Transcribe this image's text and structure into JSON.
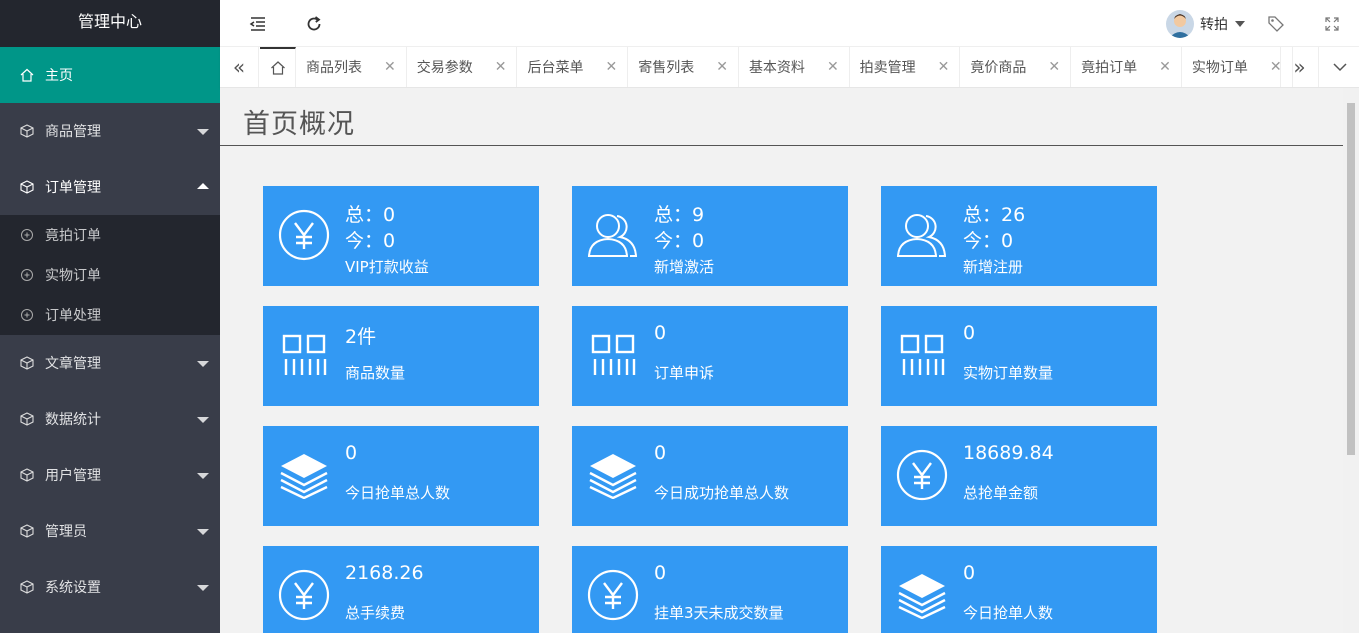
{
  "sidebar": {
    "title": "管理中心",
    "items": [
      {
        "label": "主页"
      },
      {
        "label": "商品管理"
      },
      {
        "label": "订单管理",
        "children": [
          {
            "label": "竟拍订单"
          },
          {
            "label": "实物订单"
          },
          {
            "label": "订单处理"
          }
        ]
      },
      {
        "label": "文章管理"
      },
      {
        "label": "数据统计"
      },
      {
        "label": "用户管理"
      },
      {
        "label": "管理员"
      },
      {
        "label": "系统设置"
      }
    ]
  },
  "header": {
    "user_name": "转拍",
    "icons": [
      "menu-fold-icon",
      "refresh-icon",
      "tag-icon",
      "fullscreen-icon"
    ]
  },
  "tabs": [
    "商品列表",
    "交易参数",
    "后台菜单",
    "寄售列表",
    "基本资料",
    "拍卖管理",
    "竟价商品",
    "竟拍订单",
    "实物订单"
  ],
  "page": {
    "title": "首页概况"
  },
  "cards": [
    {
      "total": "总：0",
      "today": "今：0",
      "caption": "VIP打款收益",
      "icon": "yen-icon"
    },
    {
      "total": "总：9",
      "today": "今：0",
      "caption": "新增激活",
      "icon": "users-icon"
    },
    {
      "total": "总：26",
      "today": "今：0",
      "caption": "新增注册",
      "icon": "users-icon"
    },
    {
      "value": "2件",
      "caption": "商品数量",
      "icon": "grid-icon"
    },
    {
      "value": "0",
      "caption": "订单申诉",
      "icon": "grid-icon"
    },
    {
      "value": "0",
      "caption": "实物订单数量",
      "icon": "grid-icon"
    },
    {
      "value": "0",
      "caption": "今日抢单总人数",
      "icon": "layers-icon"
    },
    {
      "value": "0",
      "caption": "今日成功抢单总人数",
      "icon": "layers-icon"
    },
    {
      "value": "18689.84",
      "caption": "总抢单金额",
      "icon": "yen-icon"
    },
    {
      "value": "2168.26",
      "caption": "总手续费",
      "icon": "yen-icon"
    },
    {
      "value": "0",
      "caption": "挂单3天未成交数量",
      "icon": "yen-icon"
    },
    {
      "value": "0",
      "caption": "今日抢单人数",
      "icon": "layers-icon"
    }
  ],
  "colors": {
    "sidebar": "#393d49",
    "active": "#009688",
    "card": "#3399f3"
  }
}
